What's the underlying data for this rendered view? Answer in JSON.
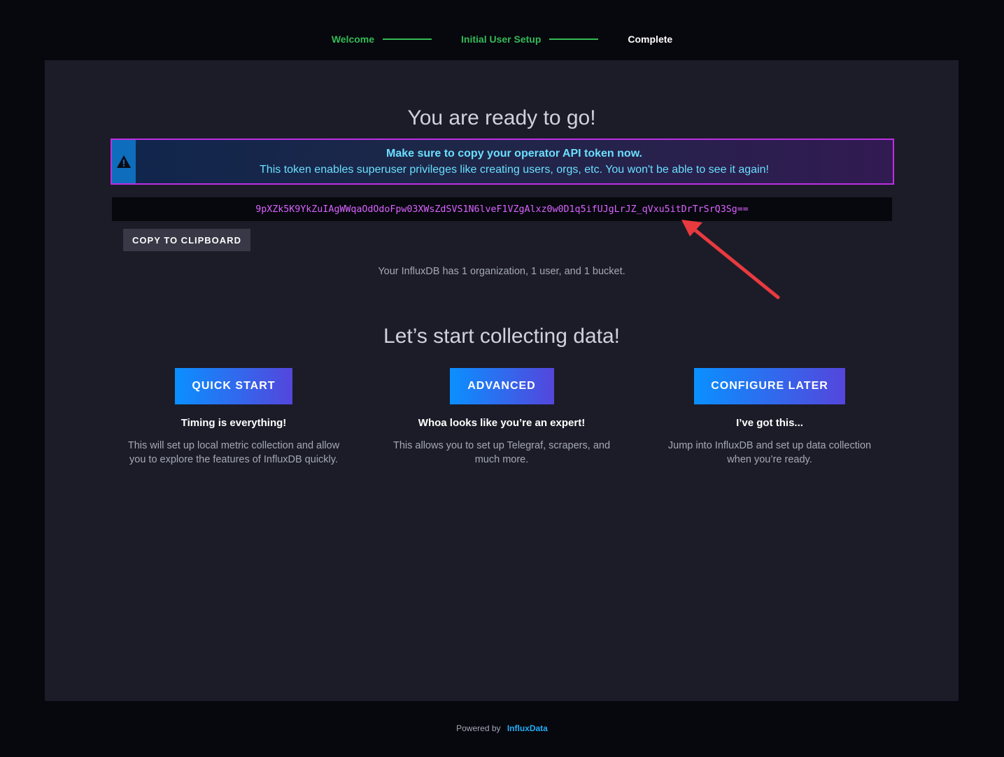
{
  "stepper": {
    "steps": [
      {
        "label": "Welcome",
        "state": "done"
      },
      {
        "label": "Initial User Setup",
        "state": "done"
      },
      {
        "label": "Complete",
        "state": "current"
      }
    ]
  },
  "main": {
    "title": "You are ready to go!",
    "alert": {
      "icon": "warning-icon",
      "heading": "Make sure to copy your operator API token now.",
      "body": "This token enables superuser privileges like creating users, orgs, etc. You won't be able to see it again!"
    },
    "token": "9pXZk5K9YkZuIAgWWqaOdOdoFpw03XWsZdSVS1N6lveF1VZgAlxz0w0D1q5ifUJgLrJZ_qVxu5itDrTrSrQ3Sg==",
    "copy_label": "COPY TO CLIPBOARD",
    "summary": "Your InfluxDB has 1 organization, 1 user, and 1 bucket.",
    "collect_title": "Let’s start collecting data!",
    "options": [
      {
        "button": "QUICK START",
        "title": "Timing is everything!",
        "desc_lines": [
          "This will set up local metric collection and allow",
          "you to explore the features of InfluxDB quickly."
        ]
      },
      {
        "button": "ADVANCED",
        "title": "Whoa looks like you’re an expert!",
        "desc_lines": [
          "This allows you to set up Telegraf, scrapers, and",
          "much more."
        ]
      },
      {
        "button": "CONFIGURE LATER",
        "title": "I’ve got this...",
        "desc_lines": [
          "Jump into InfluxDB and set up data collection",
          "when you’re ready."
        ]
      }
    ]
  },
  "footer": {
    "powered_by": "Powered by",
    "brand": "InfluxData"
  },
  "colors": {
    "step_done": "#34bb55",
    "token": "#d964ff",
    "alert_border": "#be2ee4",
    "annotation_arrow": "#e83a3f"
  }
}
